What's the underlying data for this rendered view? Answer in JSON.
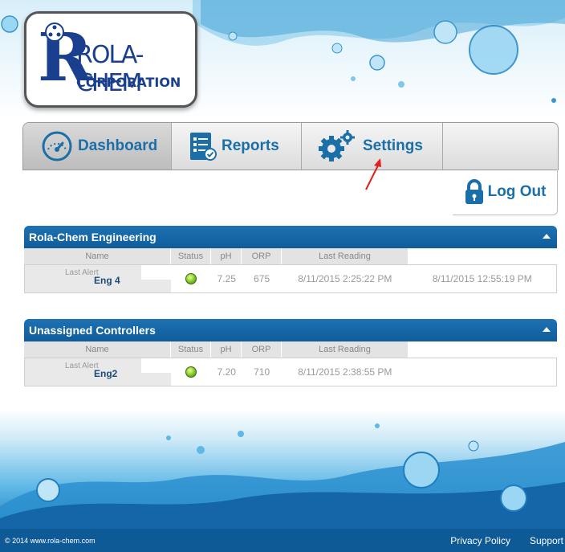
{
  "brand": {
    "name": "ROLA-CHEM",
    "corporation": "CORPORATION",
    "color": "#1a3f8f"
  },
  "nav": {
    "dashboard": "Dashboard",
    "reports": "Reports",
    "settings": "Settings",
    "logout": "Log Out",
    "accent": "#1b6fa8"
  },
  "columns": {
    "name": "Name",
    "last_alert": "Last Alert",
    "status": "Status",
    "ph": "pH",
    "orp": "ORP",
    "last_reading": "Last Reading"
  },
  "groups": [
    {
      "title": "Rola-Chem Engineering",
      "rows": [
        {
          "name": "Eng 4",
          "status_icon": "green-status-dot",
          "ph": "7.25",
          "orp": "675",
          "last_reading": "8/11/2015 2:25:22 PM",
          "last_alert": "8/11/2015 12:55:19 PM"
        }
      ]
    },
    {
      "title": "Unassigned Controllers",
      "rows": [
        {
          "name": "Eng2",
          "status_icon": "green-status-dot",
          "ph": "7.20",
          "orp": "710",
          "last_reading": "8/11/2015 2:38:55 PM",
          "last_alert": ""
        }
      ]
    }
  ],
  "footer": {
    "copyright": "© 2014 www.rola-chem.com",
    "privacy": "Privacy Policy",
    "support": "Support"
  },
  "colors": {
    "header_blue": "#1e72b3",
    "footer_blue": "#0e5a97",
    "annotation_arrow": "#e3201b"
  }
}
